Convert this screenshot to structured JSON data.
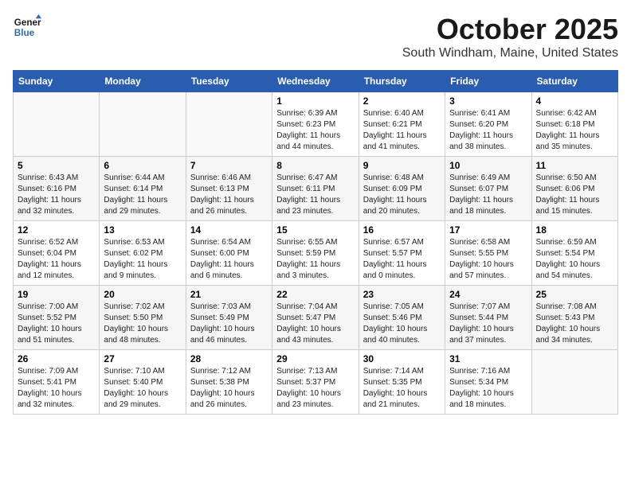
{
  "logo": {
    "line1": "General",
    "line2": "Blue"
  },
  "title": "October 2025",
  "subtitle": "South Windham, Maine, United States",
  "days_of_week": [
    "Sunday",
    "Monday",
    "Tuesday",
    "Wednesday",
    "Thursday",
    "Friday",
    "Saturday"
  ],
  "weeks": [
    [
      {
        "day": "",
        "info": ""
      },
      {
        "day": "",
        "info": ""
      },
      {
        "day": "",
        "info": ""
      },
      {
        "day": "1",
        "info": "Sunrise: 6:39 AM\nSunset: 6:23 PM\nDaylight: 11 hours and 44 minutes."
      },
      {
        "day": "2",
        "info": "Sunrise: 6:40 AM\nSunset: 6:21 PM\nDaylight: 11 hours and 41 minutes."
      },
      {
        "day": "3",
        "info": "Sunrise: 6:41 AM\nSunset: 6:20 PM\nDaylight: 11 hours and 38 minutes."
      },
      {
        "day": "4",
        "info": "Sunrise: 6:42 AM\nSunset: 6:18 PM\nDaylight: 11 hours and 35 minutes."
      }
    ],
    [
      {
        "day": "5",
        "info": "Sunrise: 6:43 AM\nSunset: 6:16 PM\nDaylight: 11 hours and 32 minutes."
      },
      {
        "day": "6",
        "info": "Sunrise: 6:44 AM\nSunset: 6:14 PM\nDaylight: 11 hours and 29 minutes."
      },
      {
        "day": "7",
        "info": "Sunrise: 6:46 AM\nSunset: 6:13 PM\nDaylight: 11 hours and 26 minutes."
      },
      {
        "day": "8",
        "info": "Sunrise: 6:47 AM\nSunset: 6:11 PM\nDaylight: 11 hours and 23 minutes."
      },
      {
        "day": "9",
        "info": "Sunrise: 6:48 AM\nSunset: 6:09 PM\nDaylight: 11 hours and 20 minutes."
      },
      {
        "day": "10",
        "info": "Sunrise: 6:49 AM\nSunset: 6:07 PM\nDaylight: 11 hours and 18 minutes."
      },
      {
        "day": "11",
        "info": "Sunrise: 6:50 AM\nSunset: 6:06 PM\nDaylight: 11 hours and 15 minutes."
      }
    ],
    [
      {
        "day": "12",
        "info": "Sunrise: 6:52 AM\nSunset: 6:04 PM\nDaylight: 11 hours and 12 minutes."
      },
      {
        "day": "13",
        "info": "Sunrise: 6:53 AM\nSunset: 6:02 PM\nDaylight: 11 hours and 9 minutes."
      },
      {
        "day": "14",
        "info": "Sunrise: 6:54 AM\nSunset: 6:00 PM\nDaylight: 11 hours and 6 minutes."
      },
      {
        "day": "15",
        "info": "Sunrise: 6:55 AM\nSunset: 5:59 PM\nDaylight: 11 hours and 3 minutes."
      },
      {
        "day": "16",
        "info": "Sunrise: 6:57 AM\nSunset: 5:57 PM\nDaylight: 11 hours and 0 minutes."
      },
      {
        "day": "17",
        "info": "Sunrise: 6:58 AM\nSunset: 5:55 PM\nDaylight: 10 hours and 57 minutes."
      },
      {
        "day": "18",
        "info": "Sunrise: 6:59 AM\nSunset: 5:54 PM\nDaylight: 10 hours and 54 minutes."
      }
    ],
    [
      {
        "day": "19",
        "info": "Sunrise: 7:00 AM\nSunset: 5:52 PM\nDaylight: 10 hours and 51 minutes."
      },
      {
        "day": "20",
        "info": "Sunrise: 7:02 AM\nSunset: 5:50 PM\nDaylight: 10 hours and 48 minutes."
      },
      {
        "day": "21",
        "info": "Sunrise: 7:03 AM\nSunset: 5:49 PM\nDaylight: 10 hours and 46 minutes."
      },
      {
        "day": "22",
        "info": "Sunrise: 7:04 AM\nSunset: 5:47 PM\nDaylight: 10 hours and 43 minutes."
      },
      {
        "day": "23",
        "info": "Sunrise: 7:05 AM\nSunset: 5:46 PM\nDaylight: 10 hours and 40 minutes."
      },
      {
        "day": "24",
        "info": "Sunrise: 7:07 AM\nSunset: 5:44 PM\nDaylight: 10 hours and 37 minutes."
      },
      {
        "day": "25",
        "info": "Sunrise: 7:08 AM\nSunset: 5:43 PM\nDaylight: 10 hours and 34 minutes."
      }
    ],
    [
      {
        "day": "26",
        "info": "Sunrise: 7:09 AM\nSunset: 5:41 PM\nDaylight: 10 hours and 32 minutes."
      },
      {
        "day": "27",
        "info": "Sunrise: 7:10 AM\nSunset: 5:40 PM\nDaylight: 10 hours and 29 minutes."
      },
      {
        "day": "28",
        "info": "Sunrise: 7:12 AM\nSunset: 5:38 PM\nDaylight: 10 hours and 26 minutes."
      },
      {
        "day": "29",
        "info": "Sunrise: 7:13 AM\nSunset: 5:37 PM\nDaylight: 10 hours and 23 minutes."
      },
      {
        "day": "30",
        "info": "Sunrise: 7:14 AM\nSunset: 5:35 PM\nDaylight: 10 hours and 21 minutes."
      },
      {
        "day": "31",
        "info": "Sunrise: 7:16 AM\nSunset: 5:34 PM\nDaylight: 10 hours and 18 minutes."
      },
      {
        "day": "",
        "info": ""
      }
    ]
  ]
}
